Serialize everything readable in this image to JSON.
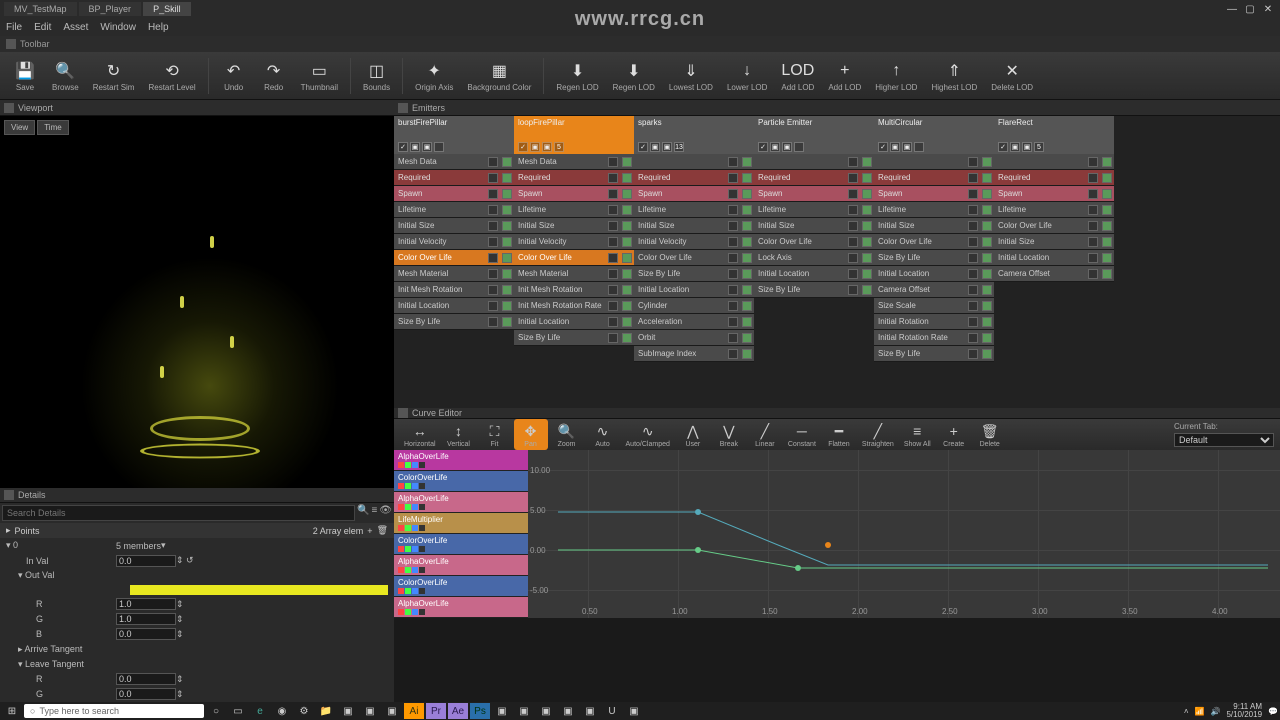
{
  "watermark": "www.rrcg.cn",
  "titlebar": {
    "tabs": [
      {
        "label": "MV_TestMap",
        "icon": "level"
      },
      {
        "label": "BP_Player",
        "icon": "bp"
      },
      {
        "label": "P_Skill",
        "icon": "particle"
      }
    ]
  },
  "menubar": [
    "File",
    "Edit",
    "Asset",
    "Window",
    "Help"
  ],
  "toolbar_label": "Toolbar",
  "main_toolbar": [
    {
      "label": "Save",
      "icon": "💾"
    },
    {
      "label": "Browse",
      "icon": "🔍"
    },
    {
      "label": "Restart Sim",
      "icon": "↻"
    },
    {
      "label": "Restart Level",
      "icon": "⟲"
    },
    {
      "sep": true
    },
    {
      "label": "Undo",
      "icon": "↶"
    },
    {
      "label": "Redo",
      "icon": "↷"
    },
    {
      "label": "Thumbnail",
      "icon": "▭"
    },
    {
      "sep": true
    },
    {
      "label": "Bounds",
      "icon": "◫"
    },
    {
      "sep": true
    },
    {
      "label": "Origin Axis",
      "icon": "✦"
    },
    {
      "label": "Background Color",
      "icon": "▦"
    },
    {
      "sep": true
    },
    {
      "label": "Regen LOD",
      "icon": "⬇"
    },
    {
      "label": "Regen LOD",
      "icon": "⬇"
    },
    {
      "label": "Lowest LOD",
      "icon": "⇓"
    },
    {
      "label": "Lower LOD",
      "icon": "↓"
    },
    {
      "label": "Add LOD",
      "icon": "LOD"
    },
    {
      "label": "Add LOD",
      "icon": "+"
    },
    {
      "label": "Higher LOD",
      "icon": "↑"
    },
    {
      "label": "Highest LOD",
      "icon": "⇑"
    },
    {
      "label": "Delete LOD",
      "icon": "✕"
    }
  ],
  "viewport": {
    "title": "Viewport",
    "buttons": [
      "View",
      "Time"
    ]
  },
  "emitters": {
    "title": "Emitters",
    "columns": [
      {
        "name": "burstFirePillar",
        "class": "grey",
        "val": "",
        "modules": [
          "Mesh Data",
          "Required",
          "Spawn",
          "Lifetime",
          "Initial Size",
          "Initial Velocity",
          "Color Over Life",
          "Mesh Material",
          "Init Mesh Rotation",
          "Initial Location",
          "Size By Life"
        ]
      },
      {
        "name": "loopFirePillar",
        "class": "orange",
        "val": "5",
        "modules": [
          "Mesh Data",
          "Required",
          "Spawn",
          "Lifetime",
          "Initial Size",
          "Initial Velocity",
          "Color Over Life",
          "Mesh Material",
          "Init Mesh Rotation",
          "Init Mesh Rotation Rate",
          "Initial Location",
          "Size By Life"
        ]
      },
      {
        "name": "sparks",
        "class": "grey",
        "val": "13",
        "modules": [
          "",
          "Required",
          "Spawn",
          "Lifetime",
          "Initial Size",
          "Initial Velocity",
          "Color Over Life",
          "Size By Life",
          "Initial Location",
          "Cylinder",
          "Acceleration",
          "Orbit",
          "SubImage Index"
        ]
      },
      {
        "name": "Particle Emitter",
        "class": "grey",
        "val": "",
        "modules": [
          "",
          "Required",
          "Spawn",
          "Lifetime",
          "Initial Size",
          "Color Over Life",
          "Lock Axis",
          "Initial Location",
          "Size By Life"
        ]
      },
      {
        "name": "MultiCircular",
        "class": "grey",
        "val": "",
        "modules": [
          "",
          "Required",
          "Spawn",
          "Lifetime",
          "Initial Size",
          "Color Over Life",
          "Size By Life",
          "Initial Location",
          "Camera Offset",
          "Size Scale",
          "Initial Rotation",
          "Initial Rotation Rate",
          "Size By Life"
        ]
      },
      {
        "name": "FlareRect",
        "class": "grey",
        "val": "5",
        "modules": [
          "",
          "Required",
          "Spawn",
          "Lifetime",
          "Color Over Life",
          "Initial Size",
          "Initial Location",
          "Camera Offset"
        ]
      }
    ]
  },
  "curve": {
    "title": "Curve Editor",
    "toolbar": [
      {
        "label": "Horizontal",
        "icon": "↔"
      },
      {
        "label": "Vertical",
        "icon": "↕"
      },
      {
        "label": "Fit",
        "icon": "⛶"
      },
      {
        "label": "Pan",
        "icon": "✥",
        "active": true
      },
      {
        "label": "Zoom",
        "icon": "🔍"
      },
      {
        "label": "Auto",
        "icon": "∿"
      },
      {
        "label": "Auto/Clamped",
        "icon": "∿"
      },
      {
        "label": "User",
        "icon": "⋀"
      },
      {
        "label": "Break",
        "icon": "⋁"
      },
      {
        "label": "Linear",
        "icon": "╱"
      },
      {
        "label": "Constant",
        "icon": "─"
      },
      {
        "label": "Flatten",
        "icon": "━"
      },
      {
        "label": "Straighten",
        "icon": "╱"
      },
      {
        "label": "Show All",
        "icon": "≡"
      },
      {
        "label": "Create",
        "icon": "+"
      },
      {
        "label": "Delete",
        "icon": "🗑"
      }
    ],
    "current_tab_label": "Current Tab:",
    "current_tab_value": "Default",
    "items": [
      {
        "label": "AlphaOverLife",
        "cls": "ci-magenta"
      },
      {
        "label": "ColorOverLife",
        "cls": "ci-blue"
      },
      {
        "label": "AlphaOverLife",
        "cls": "ci-pink"
      },
      {
        "label": "LifeMultiplier",
        "cls": "ci-gold"
      },
      {
        "label": "ColorOverLife",
        "cls": "ci-blue"
      },
      {
        "label": "AlphaOverLife",
        "cls": "ci-pink"
      },
      {
        "label": "ColorOverLife",
        "cls": "ci-blue"
      },
      {
        "label": "AlphaOverLife",
        "cls": "ci-pink"
      }
    ],
    "yticks": [
      "10.00",
      "5.00",
      "0.00",
      "-5.00"
    ],
    "xticks": [
      "0.50",
      "1.00",
      "1.50",
      "2.00",
      "2.50",
      "3.00",
      "3.50",
      "4.00"
    ]
  },
  "details": {
    "title": "Details",
    "search_placeholder": "Search Details",
    "cat_points": "Points",
    "array_label": "2 Array elem",
    "members": "5 members",
    "inval_label": "In Val",
    "inval": "0.0",
    "outval_label": "Out Val",
    "r_label": "R",
    "r": "1.0",
    "g_label": "G",
    "g": "1.0",
    "b_label": "B",
    "b": "0.0",
    "arrive_label": "Arrive Tangent",
    "leave_label": "Leave Tangent",
    "r2": "0.0",
    "g2": "0.0"
  },
  "taskbar": {
    "search_placeholder": "Type here to search",
    "time": "9:11 AM",
    "date": "5/10/2019"
  }
}
